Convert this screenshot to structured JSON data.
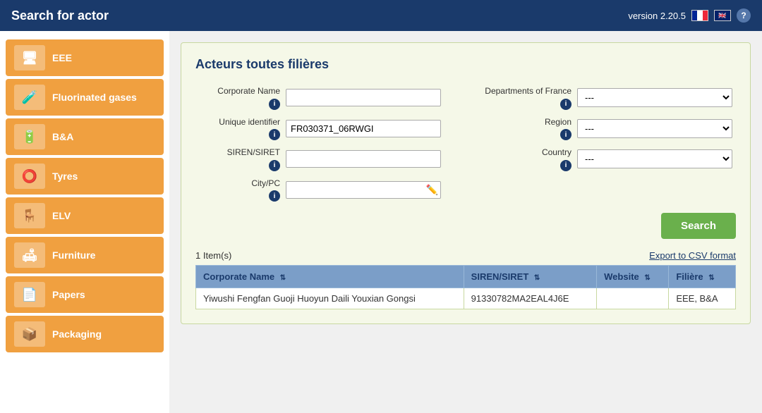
{
  "header": {
    "title": "Search for actor",
    "version": "version 2.20.5"
  },
  "sidebar": {
    "items": [
      {
        "id": "eee",
        "label": "EEE",
        "icon": "🖥"
      },
      {
        "id": "fluorinated-gases",
        "label": "Fluorinated gases",
        "icon": "🧪"
      },
      {
        "id": "ba",
        "label": "B&A",
        "icon": "🔋"
      },
      {
        "id": "tyres",
        "label": "Tyres",
        "icon": "⭕"
      },
      {
        "id": "elv",
        "label": "ELV",
        "icon": "🪑"
      },
      {
        "id": "furniture",
        "label": "Furniture",
        "icon": "🛋"
      },
      {
        "id": "papers",
        "label": "Papers",
        "icon": "📄"
      },
      {
        "id": "packaging",
        "label": "Packaging",
        "icon": "📦"
      }
    ]
  },
  "panel": {
    "title": "Acteurs toutes filières"
  },
  "form": {
    "corporate_name_label": "Corporate Name",
    "corporate_name_value": "",
    "corporate_name_placeholder": "",
    "unique_id_label": "Unique identifier",
    "unique_id_value": "FR030371_06RWGI",
    "siren_label": "SIREN/SIRET",
    "siren_value": "",
    "siren_placeholder": "",
    "city_label": "City/PC",
    "city_value": "",
    "city_placeholder": "",
    "departments_label": "Departments of France",
    "departments_value": "---",
    "region_label": "Region",
    "region_value": "---",
    "country_label": "Country",
    "country_value": "---",
    "search_button": "Search",
    "export_link": "Export to CSV format"
  },
  "results": {
    "count_label": "1 Item(s)",
    "columns": [
      {
        "key": "corporate_name",
        "label": "Corporate Name"
      },
      {
        "key": "siren_siret",
        "label": "SIREN/SIRET"
      },
      {
        "key": "website",
        "label": "Website"
      },
      {
        "key": "filiere",
        "label": "Filière"
      }
    ],
    "rows": [
      {
        "corporate_name": "Yiwushi Fengfan Guoji Huoyun Daili Youxian Gongsi",
        "siren_siret": "91330782MA2EAL4J6E",
        "website": "",
        "filiere": "EEE, B&A"
      }
    ]
  },
  "select_options": {
    "departments": [
      "---"
    ],
    "region": [
      "---"
    ],
    "country": [
      "---"
    ]
  }
}
